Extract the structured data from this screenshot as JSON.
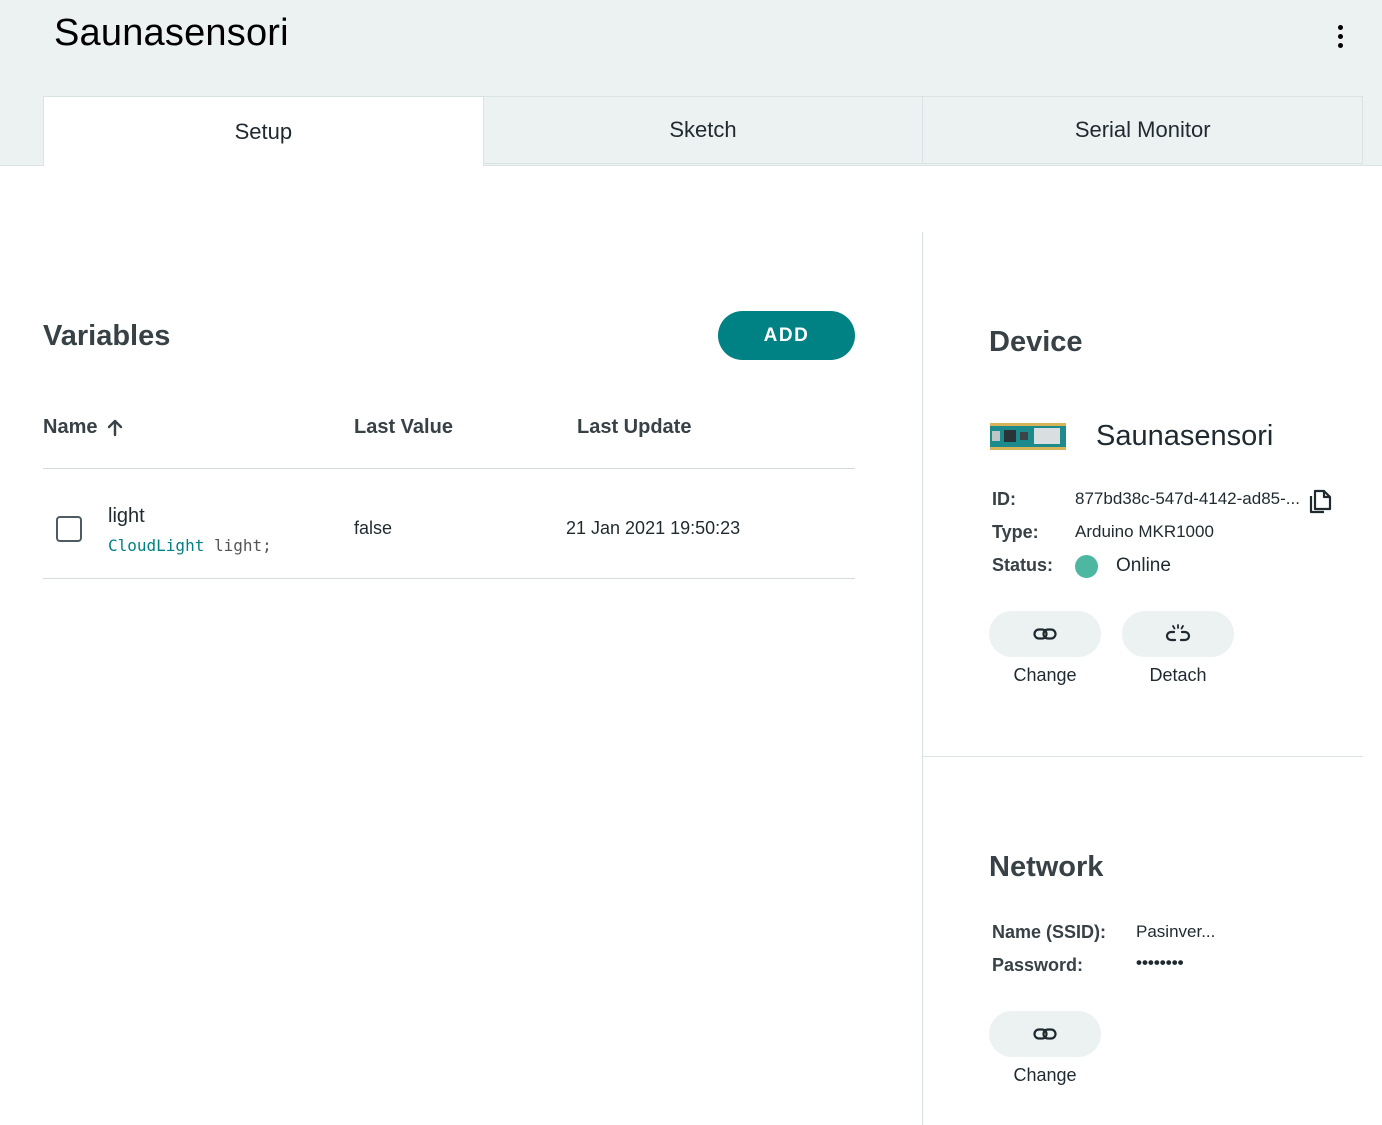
{
  "header": {
    "thing_title": "Saunasensori",
    "menu_icon": "more-vertical-icon"
  },
  "tabs": [
    {
      "label": "Setup",
      "active": true
    },
    {
      "label": "Sketch",
      "active": false
    },
    {
      "label": "Serial Monitor",
      "active": false
    }
  ],
  "variables": {
    "title": "Variables",
    "add_label": "ADD",
    "columns": {
      "name": "Name",
      "name_sort_icon": "arrow-up-icon",
      "last_value": "Last Value",
      "last_update": "Last Update"
    },
    "rows": [
      {
        "name": "light",
        "decl_type": "CloudLight",
        "decl_rest": " light;",
        "last_value": "false",
        "last_update": "21 Jan 2021 19:50:23",
        "checked": false
      }
    ]
  },
  "device": {
    "title": "Device",
    "board_icon": "arduino-board-icon",
    "name": "Saunasensori",
    "id_label": "ID:",
    "id_value": "877bd38c-547d-4142-ad85-...",
    "type_label": "Type:",
    "type_value": "Arduino MKR1000",
    "status_label": "Status:",
    "status_value": "Online",
    "status_color": "#4db7a2",
    "change_label": "Change",
    "detach_label": "Detach"
  },
  "network": {
    "title": "Network",
    "ssid_label": "Name (SSID):",
    "ssid_value": "Pasinver...",
    "password_label": "Password:",
    "password_value": "••••••••",
    "change_label": "Change"
  },
  "colors": {
    "accent": "#008184",
    "header_bg": "#ecf1f1",
    "online": "#4db7a2"
  }
}
